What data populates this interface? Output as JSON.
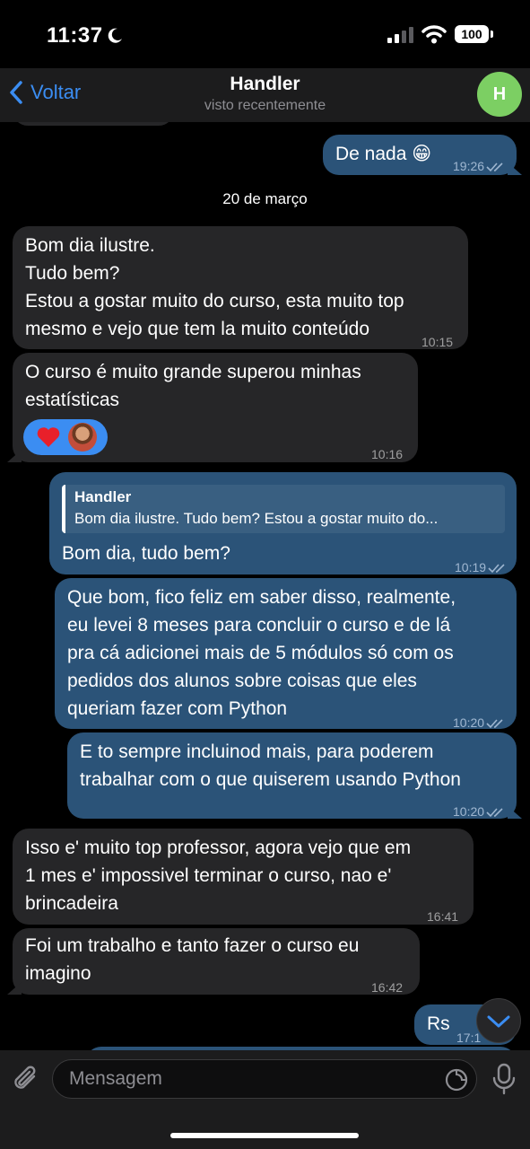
{
  "status_bar": {
    "time": "11:37",
    "battery": "100"
  },
  "header": {
    "back_label": "Voltar",
    "title": "Handler",
    "subtitle": "visto recentemente",
    "avatar_initial": "H"
  },
  "messages": [
    {
      "direction": "out",
      "text": "De nada 😁",
      "time": "19:26",
      "read": true
    },
    {
      "type": "date",
      "text": "20 de março"
    },
    {
      "direction": "in",
      "text": "Bom dia ilustre.\nTudo bem?\nEstou a gostar muito do curso, esta muito top\nmesmo e vejo que tem la muito conteúdo",
      "time": "10:15"
    },
    {
      "direction": "in",
      "text": "O curso é muito grande superou minhas\nestatísticas",
      "time": "10:16",
      "reactions": [
        "heart-emoji",
        "user-avatar"
      ]
    },
    {
      "direction": "out",
      "reply_to": {
        "name": "Handler",
        "text": "Bom dia ilustre. Tudo bem? Estou a gostar muito do..."
      },
      "text": "Bom dia, tudo bem?",
      "time": "10:19",
      "read": true
    },
    {
      "direction": "out",
      "text": "Que bom, fico feliz em saber disso, realmente,\neu levei 8 meses para concluir o curso e de lá\npra cá adicionei mais de 5 módulos só com os\npedidos dos alunos sobre coisas que eles\nqueriam fazer com Python",
      "time": "10:20",
      "read": true
    },
    {
      "direction": "out",
      "text": "E to sempre incluinod mais, para poderem\ntrabalhar com o que quiserem usando Python",
      "time": "10:20",
      "read": true
    },
    {
      "direction": "in",
      "text": "Isso e' muito top professor, agora vejo que em\n1 mes e' impossivel terminar o curso, nao e'\nbrincadeira",
      "time": "16:41"
    },
    {
      "direction": "in",
      "text": "Foi um  trabalho e tanto fazer o curso eu\nimagino",
      "time": "16:42"
    },
    {
      "direction": "out",
      "text": "Rs",
      "time": "17:1"
    }
  ],
  "composer": {
    "placeholder": "Mensagem"
  },
  "colors": {
    "accent": "#3b8df2",
    "incoming_bubble": "#262628",
    "outgoing_bubble": "#2b5378",
    "avatar": "#7ccf63"
  },
  "icons": [
    "moon-icon",
    "signal-icon",
    "wifi-icon",
    "battery-icon",
    "back-chevron-icon",
    "read-checks-icon",
    "heart-emoji",
    "paperclip-icon",
    "sticker-icon",
    "microphone-icon",
    "chevron-down-icon"
  ]
}
